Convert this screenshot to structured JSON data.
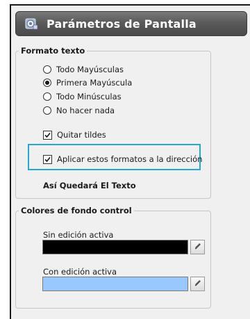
{
  "header": {
    "title": "Parámetros de Pantalla",
    "icon": "gear-stack-icon"
  },
  "formato": {
    "legend": "Formato texto",
    "options": [
      {
        "label": "Todo Mayúsculas",
        "selected": false
      },
      {
        "label": "Primera Mayúscula",
        "selected": true
      },
      {
        "label": "Todo Minúsculas",
        "selected": false
      },
      {
        "label": "No hacer nada",
        "selected": false
      }
    ],
    "quitar_tildes": {
      "label": "Quitar tildes",
      "checked": true
    },
    "aplicar_direccion": {
      "label": "Aplicar estos formatos a la dirección",
      "checked": true
    },
    "preview": "Así Quedará El Texto"
  },
  "colores": {
    "legend": "Colores de fondo control",
    "sin_edicion": {
      "label": "Sin edición activa",
      "color": "#000000"
    },
    "con_edicion": {
      "label": "Con edición activa",
      "color": "#99c8ff"
    }
  },
  "accent": {
    "highlight": "#22a8d8",
    "header": "#5a5a5a"
  }
}
